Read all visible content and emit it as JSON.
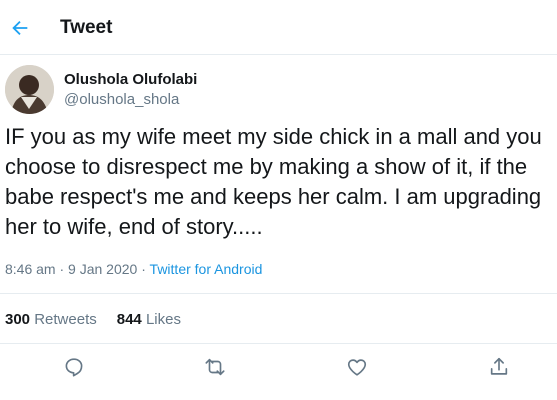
{
  "header": {
    "title": "Tweet",
    "back_icon": "arrow-left-icon"
  },
  "colors": {
    "accent": "#1b95e0",
    "secondary_text": "#657786",
    "primary_text": "#14171a",
    "divider": "#e6ecf0"
  },
  "author": {
    "display_name": "Olushola Olufolabi",
    "handle": "@olushola_shola"
  },
  "tweet": {
    "text": "IF you as my wife meet my side chick in a mall and you\nchoose to disrespect me by making a show of it, if the\nbabe respect's me and keeps her calm. I am upgrading\nher to wife, end of story.....",
    "time": "8:46 am",
    "separator1": " · ",
    "date": "9 Jan 2020",
    "separator2": " · ",
    "source": "Twitter for Android"
  },
  "stats": {
    "retweets_count": "300",
    "retweets_label": "Retweets",
    "likes_count": "844",
    "likes_label": "Likes"
  },
  "actions": [
    "reply-icon",
    "retweet-icon",
    "like-icon",
    "share-icon"
  ]
}
